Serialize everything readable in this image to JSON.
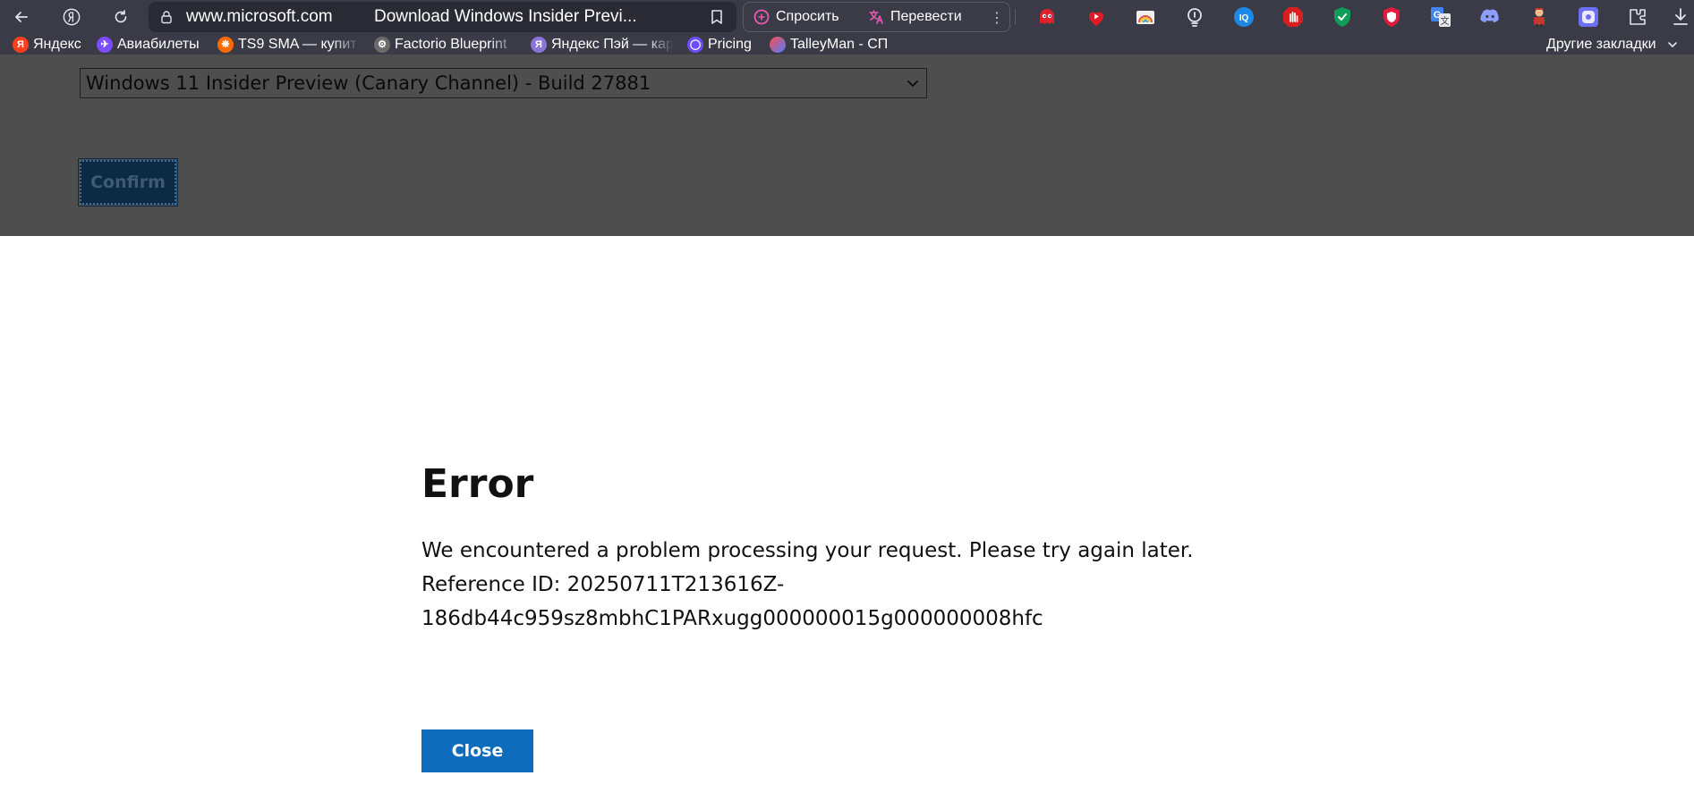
{
  "browser": {
    "url": "www.microsoft.com",
    "tab_title": "Download Windows Insider Previ...",
    "ask_label": "Спросить",
    "translate_label": "Перевести",
    "more_symbol": "⋮",
    "extensions": [
      "pacman-ghost-icon",
      "youtube-icon",
      "rainbow-icon",
      "lightbulb-icon",
      "iq-icon",
      "stop-hand-icon",
      "shield-check-icon",
      "shield-red-icon",
      "translate-icon",
      "discord-icon",
      "character-icon",
      "purple-app-icon",
      "extensions-icon",
      "download-icon"
    ]
  },
  "bookmarks": {
    "items": [
      {
        "label": "Яндекс",
        "icon": "yandex-icon",
        "color": "#fc3f1d",
        "glyph": "Я"
      },
      {
        "label": "Авиабилеты",
        "icon": "plane-icon",
        "color": "#7b4dff",
        "glyph": "✈"
      },
      {
        "label": "TS9 SMA — купит",
        "icon": "flame-icon",
        "color": "#ff6a00",
        "glyph": "❋"
      },
      {
        "label": "Factorio Blueprint",
        "icon": "gear-icon",
        "color": "#6b6b6b",
        "glyph": "⚙"
      },
      {
        "label": "Яндекс Пэй — кар",
        "icon": "yandex-pay-icon",
        "color": "#8a74d9",
        "glyph": "Я"
      },
      {
        "label": "Pricing",
        "icon": "circle-icon",
        "color": "#6d4dff",
        "glyph": "◯"
      },
      {
        "label": "TalleyMan - СП",
        "icon": "ball-icon",
        "color": "#e84d4d",
        "glyph": ""
      }
    ],
    "other_label": "Другие закладки"
  },
  "page": {
    "edition_selected": "Windows 11 Insider Preview (Canary Channel) - Build 27881",
    "confirm_label": "Confirm"
  },
  "dialog": {
    "title": "Error",
    "message": "We encountered a problem processing your request. Please try again later.",
    "ref_line1": "Reference ID: 20250711T213616Z-",
    "ref_line2": "186db44c959sz8mbhC1PARxugg000000015g000000008hfc",
    "close_label": "Close"
  },
  "colors": {
    "chrome_bg": "#3b3b48",
    "overlay_bg": "#4e4e4e",
    "close_button": "#0f6cbd",
    "confirm_button": "#0c2a44"
  }
}
